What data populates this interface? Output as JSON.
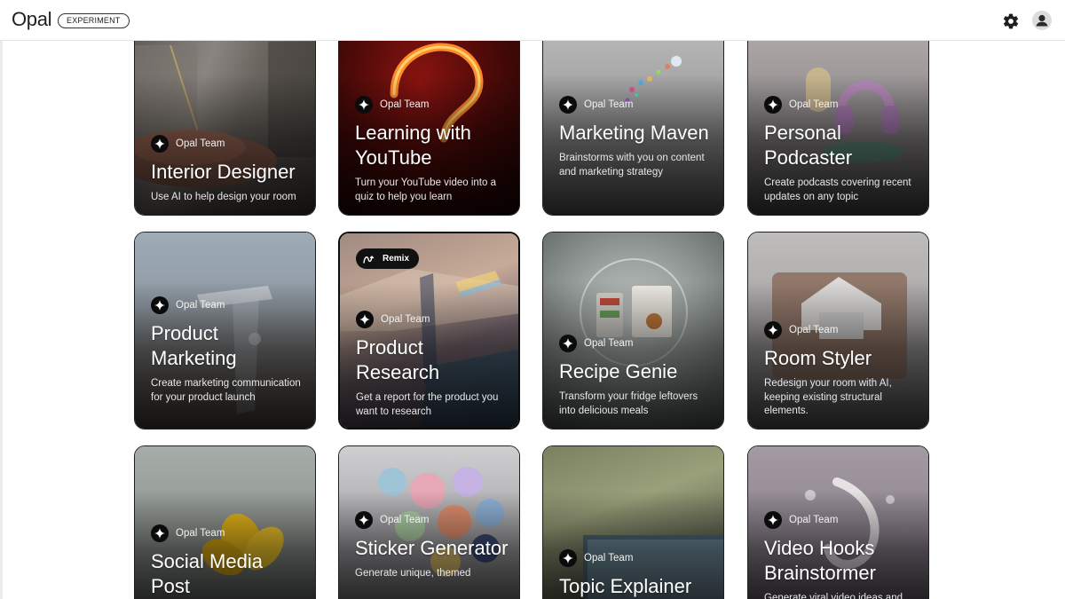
{
  "header": {
    "app_title": "Opal",
    "badge": "EXPERIMENT",
    "settings_icon": "gear-icon",
    "account_icon": "account-icon"
  },
  "cards": [
    {
      "author": "Opal Team",
      "title": "Interior Designer",
      "description": "Use AI to help design your room"
    },
    {
      "author": "Opal Team",
      "title": "Learning with YouTube",
      "description": "Turn your YouTube video into a quiz to help you learn"
    },
    {
      "author": "Opal Team",
      "title": "Marketing Maven",
      "description": "Brainstorms with you on content and marketing strategy"
    },
    {
      "author": "Opal Team",
      "title": "Personal Podcaster",
      "description": "Create podcasts covering recent updates on any topic"
    },
    {
      "author": "Opal Team",
      "title": "Product Marketing",
      "description": "Create marketing communication for your product launch"
    },
    {
      "author": "Opal Team",
      "title": "Product Research",
      "description": "Get a report for the product you want to research",
      "remix_label": "Remix"
    },
    {
      "author": "Opal Team",
      "title": "Recipe Genie",
      "description": "Transform your fridge leftovers into delicious meals"
    },
    {
      "author": "Opal Team",
      "title": "Room Styler",
      "description": "Redesign your room with AI, keeping existing structural elements."
    },
    {
      "author": "Opal Team",
      "title": "Social Media Post",
      "description": ""
    },
    {
      "author": "Opal Team",
      "title": "Sticker Generator",
      "description": "Generate unique, themed"
    },
    {
      "author": "Opal Team",
      "title": "Topic Explainer",
      "description": ""
    },
    {
      "author": "Opal Team",
      "title": "Video Hooks Brainstormer",
      "description": "Generate viral video ideas and"
    }
  ],
  "theme": {
    "author_icon": "sparkle-icon",
    "remix_icon": "remix-icon"
  }
}
